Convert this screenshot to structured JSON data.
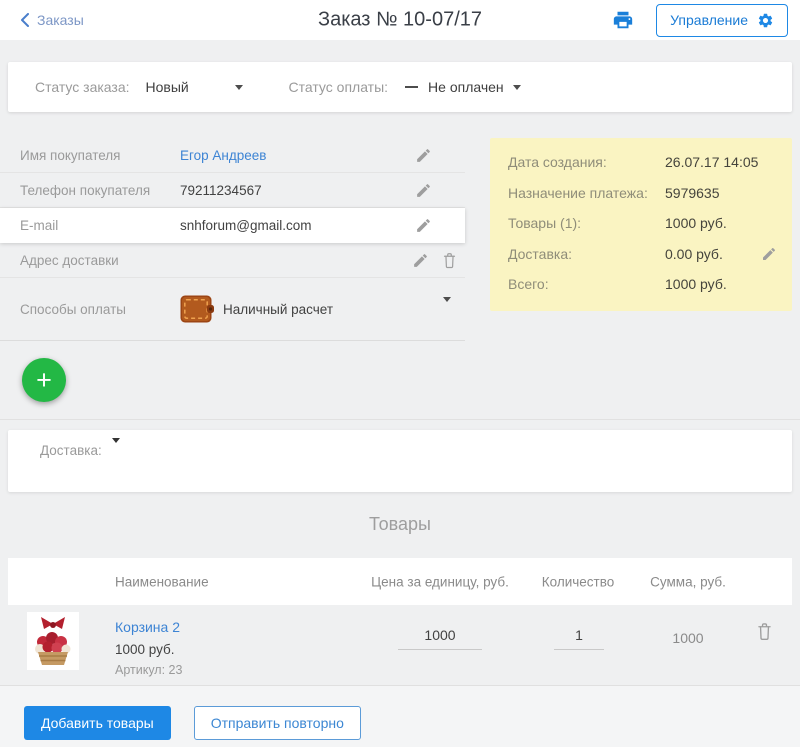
{
  "colors": {
    "accent_blue": "#1e88e5",
    "fab_green": "#23b845",
    "summary_yellow": "#faf4c2"
  },
  "header": {
    "back_label": "Заказы",
    "title": "Заказ № 10-07/17",
    "manage_label": "Управление"
  },
  "status_bar": {
    "order_status_label": "Статус заказа:",
    "order_status_value": "Новый",
    "payment_status_label": "Статус оплаты:",
    "payment_status_value": "Не оплачен"
  },
  "customer": {
    "rows": [
      {
        "label": "Имя покупателя",
        "value": "Егор Андреев"
      },
      {
        "label": "Телефон покупателя",
        "value": "79211234567"
      },
      {
        "label": "E-mail",
        "value": "snhforum@gmail.com"
      },
      {
        "label": "Адрес доставки",
        "value": ""
      },
      {
        "label": "Способы оплаты",
        "value": "Наличный расчет"
      }
    ]
  },
  "summary": {
    "rows": [
      {
        "label": "Дата создания:",
        "value": "26.07.17 14:05"
      },
      {
        "label": "Назначение платежа:",
        "value": "5979635"
      },
      {
        "label": "Товары (1):",
        "value": "1000 руб."
      },
      {
        "label": "Доставка:",
        "value": "0.00 руб."
      },
      {
        "label": "Всего:",
        "value": "1000 руб."
      }
    ]
  },
  "fab": {
    "plus": "+"
  },
  "delivery": {
    "label": "Доставка:"
  },
  "products": {
    "title": "Товары",
    "headers": [
      "Наименование",
      "Цена за единицу, руб.",
      "Количество",
      "Сумма, руб."
    ],
    "rows": [
      {
        "name": "Корзина 2",
        "price_label": "1000 руб.",
        "sku": "Артикул: 23",
        "unit_price": "1000",
        "quantity": "1",
        "total": "1000"
      }
    ]
  },
  "footer": {
    "add_products_label": "Добавить товары",
    "resend_label": "Отправить повторно"
  }
}
